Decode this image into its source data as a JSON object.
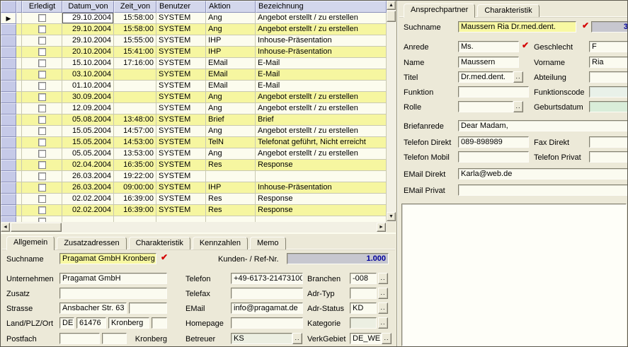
{
  "colors": {
    "app_background": "#ece9d8",
    "row_highlight": "#f6f6a0",
    "field_highlight": "#f8f8a2",
    "readonly_field": "#c7c7cf",
    "readonly_text": "#00009b",
    "check_icon": "#d40000",
    "grid_header": "#d3d7ec"
  },
  "icons": {
    "dots": "..",
    "check": "✔",
    "record_arrow": "▶",
    "up": "▲",
    "down": "▼",
    "left": "◄",
    "right": "►"
  },
  "table": {
    "columns": [
      "Erledigt",
      "Datum_von",
      "Zeit_von",
      "Benutzer",
      "Aktion",
      "Bezeichnung"
    ],
    "rows": [
      {
        "selected": true,
        "date": "29.10.2004",
        "time": "15:58:00",
        "user": "SYSTEM",
        "action": "Ang",
        "desc": "Angebot erstellt / zu erstellen"
      },
      {
        "selected": false,
        "date": "29.10.2004",
        "time": "15:58:00",
        "user": "SYSTEM",
        "action": "Ang",
        "desc": "Angebot erstellt / zu erstellen"
      },
      {
        "selected": false,
        "date": "29.10.2004",
        "time": "15:55:00",
        "user": "SYSTEM",
        "action": "IHP",
        "desc": "Inhouse-Präsentation"
      },
      {
        "selected": false,
        "date": "20.10.2004",
        "time": "15:41:00",
        "user": "SYSTEM",
        "action": "IHP",
        "desc": "Inhouse-Präsentation"
      },
      {
        "selected": false,
        "date": "15.10.2004",
        "time": "17:16:00",
        "user": "SYSTEM",
        "action": "EMail",
        "desc": "E-Mail"
      },
      {
        "selected": false,
        "date": "03.10.2004",
        "time": "",
        "user": "SYSTEM",
        "action": "EMail",
        "desc": "E-Mail"
      },
      {
        "selected": false,
        "date": "01.10.2004",
        "time": "",
        "user": "SYSTEM",
        "action": "EMail",
        "desc": "E-Mail"
      },
      {
        "selected": false,
        "date": "30.09.2004",
        "time": "",
        "user": "SYSTEM",
        "action": "Ang",
        "desc": "Angebot erstellt / zu erstellen"
      },
      {
        "selected": false,
        "date": "12.09.2004",
        "time": "",
        "user": "SYSTEM",
        "action": "Ang",
        "desc": "Angebot erstellt / zu erstellen"
      },
      {
        "selected": false,
        "date": "05.08.2004",
        "time": "13:48:00",
        "user": "SYSTEM",
        "action": "Brief",
        "desc": "Brief"
      },
      {
        "selected": false,
        "date": "15.05.2004",
        "time": "14:57:00",
        "user": "SYSTEM",
        "action": "Ang",
        "desc": "Angebot erstellt / zu erstellen"
      },
      {
        "selected": false,
        "date": "15.05.2004",
        "time": "14:53:00",
        "user": "SYSTEM",
        "action": "TelN",
        "desc": "Telefonat geführt, Nicht erreicht"
      },
      {
        "selected": false,
        "date": "05.05.2004",
        "time": "13:53:00",
        "user": "SYSTEM",
        "action": "Ang",
        "desc": "Angebot erstellt / zu erstellen"
      },
      {
        "selected": false,
        "date": "02.04.2004",
        "time": "16:35:00",
        "user": "SYSTEM",
        "action": "Res",
        "desc": "Response"
      },
      {
        "selected": false,
        "date": "26.03.2004",
        "time": "19:22:00",
        "user": "SYSTEM",
        "action": "",
        "desc": ""
      },
      {
        "selected": false,
        "date": "26.03.2004",
        "time": "09:00:00",
        "user": "SYSTEM",
        "action": "IHP",
        "desc": "Inhouse-Präsentation"
      },
      {
        "selected": false,
        "date": "02.02.2004",
        "time": "16:39:00",
        "user": "SYSTEM",
        "action": "Res",
        "desc": "Response"
      },
      {
        "selected": false,
        "date": "02.02.2004",
        "time": "16:39:00",
        "user": "SYSTEM",
        "action": "Res",
        "desc": "Response"
      },
      {
        "selected": false,
        "date": "",
        "time": "",
        "user": "",
        "action": "",
        "desc": ""
      }
    ]
  },
  "contact": {
    "tabs": [
      "Ansprechpartner",
      "Charakteristik"
    ],
    "suchname_label": "Suchname",
    "suchname": "Maussern Ria Dr.med.dent.",
    "ref_no": "3",
    "anrede_label": "Anrede",
    "anrede": "Ms.",
    "geschlecht_label": "Geschlecht",
    "geschlecht": "F",
    "name_label": "Name",
    "name": "Maussern",
    "vorname_label": "Vorname",
    "vorname": "Ria",
    "titel_label": "Titel",
    "titel": "Dr.med.dent.",
    "abteilung_label": "Abteilung",
    "abteilung": "",
    "funktion_label": "Funktion",
    "funktion": "",
    "funktionscode_label": "Funktionscode",
    "funktionscode": "",
    "rolle_label": "Rolle",
    "rolle": "",
    "geburtsdatum_label": "Geburtsdatum",
    "geburtsdatum": "",
    "briefanrede_label": "Briefanrede",
    "briefanrede": "Dear Madam,",
    "tel_direkt_label": "Telefon Direkt",
    "tel_direkt": "089-898989",
    "fax_direkt_label": "Fax Direkt",
    "fax_direkt": "",
    "tel_mobil_label": "Telefon Mobil",
    "tel_mobil": "",
    "tel_privat_label": "Telefon Privat",
    "tel_privat": "",
    "email_direkt_label": "EMail Direkt",
    "email_direkt": "Karla@web.de",
    "email_privat_label": "EMail Privat",
    "email_privat": "",
    "memo": ""
  },
  "company": {
    "tabs": [
      "Allgemein",
      "Zusatzadressen",
      "Charakteristik",
      "Kennzahlen",
      "Memo"
    ],
    "suchname_label": "Suchname",
    "suchname": "Pragamat GmbH Kronberg",
    "kunden_label": "Kunden- / Ref-Nr.",
    "kunden_nr": "1.000",
    "unternehmen_label": "Unternehmen",
    "unternehmen": "Pragamat GmbH",
    "telefon_label": "Telefon",
    "telefon": "+49-6173-21473100",
    "branchen_label": "Branchen",
    "branchen": "-008",
    "zusatz_label": "Zusatz",
    "zusatz": "",
    "telefax_label": "Telefax",
    "telefax": "",
    "adrtyp_label": "Adr-Typ",
    "adrtyp": "",
    "strasse_label": "Strasse",
    "strasse": "Ansbacher Str. 63",
    "strasse2": "",
    "email_label": "EMail",
    "email": "info@pragamat.de",
    "adrstatus_label": "Adr-Status",
    "adrstatus": "KD",
    "land_label": "Land/PLZ/Ort",
    "land": "DE",
    "plz": "61476",
    "ort": "Kronberg",
    "ort2": "",
    "homepage_label": "Homepage",
    "homepage": "",
    "kategorie_label": "Kategorie",
    "kategorie": "",
    "postfach_label": "Postfach",
    "postfach": "",
    "postfach_plz": "",
    "postfach_ort": "Kronberg",
    "betreuer_label": "Betreuer",
    "betreuer": "KS",
    "verkgebiet_label": "VerkGebiet",
    "verkgebiet": "DE_WE"
  }
}
